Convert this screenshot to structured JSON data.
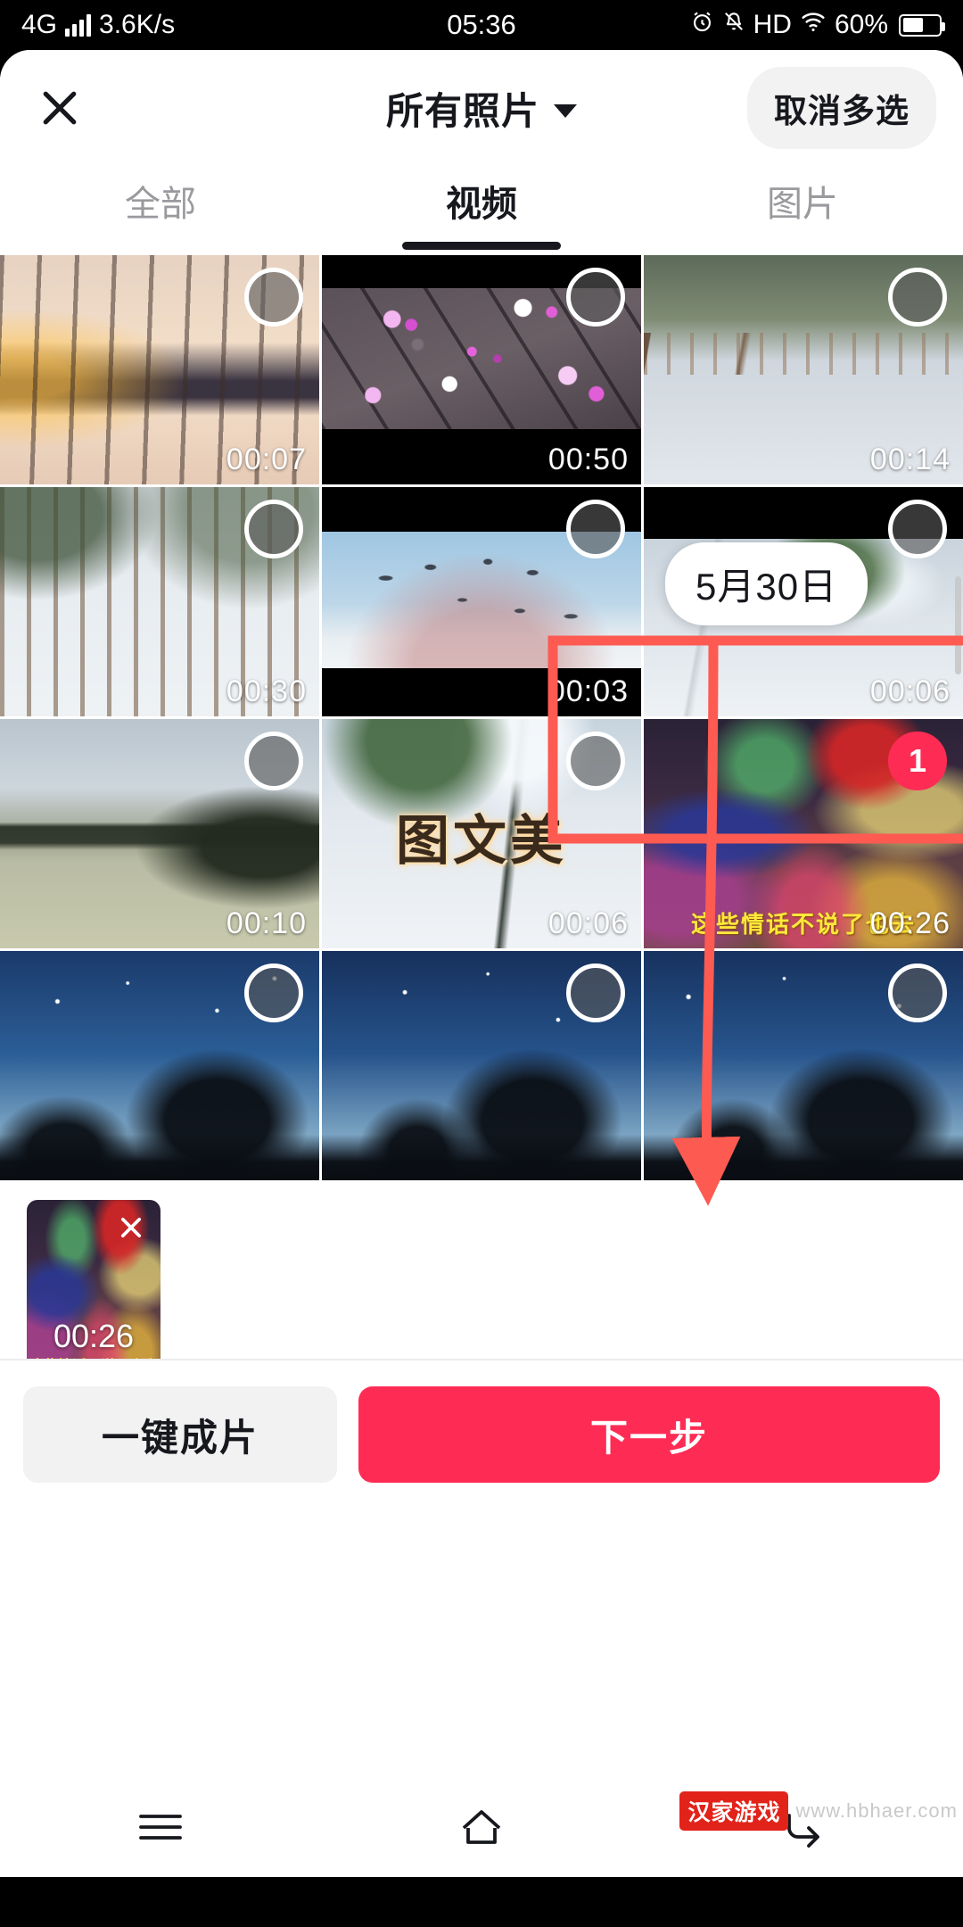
{
  "statusbar": {
    "network": "4G",
    "speed": "3.6K/s",
    "time": "05:36",
    "alarm_icon": "alarm-icon",
    "mute_icon": "bell-off-icon",
    "hd": "HD",
    "wifi_icon": "wifi-icon",
    "battery_percent": "60%"
  },
  "header": {
    "close_icon": "close-icon",
    "album_title": "所有照片",
    "chevron_icon": "chevron-down-icon",
    "multiselect_label": "取消多选"
  },
  "tabs": [
    {
      "label": "全部",
      "active": false
    },
    {
      "label": "视频",
      "active": true
    },
    {
      "label": "图片",
      "active": false
    }
  ],
  "grid": {
    "date_tooltip": "5月30日",
    "cells": [
      {
        "duration": "00:07",
        "selected": false,
        "badge": ""
      },
      {
        "duration": "00:50",
        "selected": false,
        "badge": ""
      },
      {
        "duration": "00:14",
        "selected": false,
        "badge": ""
      },
      {
        "duration": "00:30",
        "selected": false,
        "badge": ""
      },
      {
        "duration": "00:03",
        "selected": false,
        "badge": ""
      },
      {
        "duration": "00:06",
        "selected": false,
        "badge": ""
      },
      {
        "duration": "00:10",
        "selected": false,
        "badge": ""
      },
      {
        "duration": "00:06",
        "selected": false,
        "badge": ""
      },
      {
        "duration": "00:26",
        "selected": true,
        "badge": "1"
      },
      {
        "duration": "",
        "selected": false,
        "badge": ""
      },
      {
        "duration": "",
        "selected": false,
        "badge": ""
      },
      {
        "duration": "",
        "selected": false,
        "badge": ""
      }
    ],
    "overlay_texts": {
      "cell8_title": "图文美",
      "cell9_caption": "这些情话不说了也去"
    }
  },
  "tray": {
    "remove_icon": "close-icon",
    "duration": "00:26",
    "caption": "这些情话不说了也去"
  },
  "actions": {
    "auto_label": "一键成片",
    "next_label": "下一步"
  },
  "navbar": {
    "menu_icon": "menu-icon",
    "home_icon": "home-icon",
    "back_icon": "back-icon"
  },
  "watermark": {
    "badge": "汉家游戏",
    "text": "www.hbhaer.com"
  },
  "colors": {
    "accent": "#fe2c55",
    "annotation": "#fd5a52",
    "text_primary": "#16181d",
    "text_muted": "#9a9a9e",
    "chip_bg": "#f2f2f3"
  }
}
